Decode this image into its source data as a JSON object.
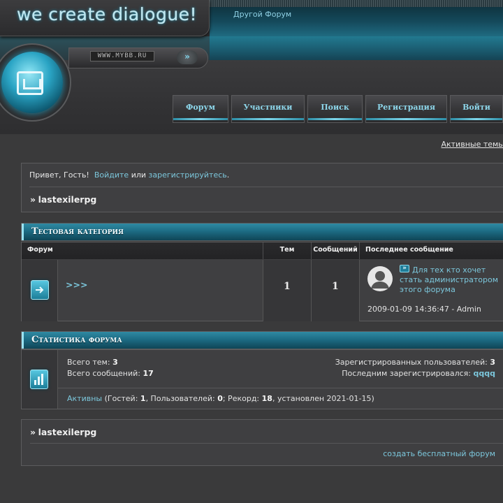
{
  "header": {
    "logo_text": "we create dialogue!",
    "other_forum_link": "Другой Форум",
    "site_url": "WWW.MYBB.RU",
    "url_arrow": "»"
  },
  "nav": [
    {
      "label": "Форум"
    },
    {
      "label": "Участники"
    },
    {
      "label": "Поиск"
    },
    {
      "label": "Регистрация"
    },
    {
      "label": "Войти"
    }
  ],
  "active_topics_link": "Активные темы",
  "welcome": {
    "greeting": "Привет, Гость!",
    "login_link": "Войдите",
    "or": "или",
    "register_link": "зарегистрируйтесь",
    "period": ".",
    "crumb_prefix": "»",
    "crumb": "lastexilerpg"
  },
  "category": {
    "title": "Тестовая категория",
    "columns": {
      "forum": "Форум",
      "topics": "Тем",
      "posts": "Сообщений",
      "last_post": "Последнее сообщение"
    },
    "rows": [
      {
        "name": ">>>",
        "topics": "1",
        "posts": "1",
        "last_post_link": "Для тех кто хочет стать администратором этого форума",
        "last_post_meta": "2009-01-09 14:36:47 - Admin"
      }
    ]
  },
  "stats": {
    "title": "Статистика форума",
    "total_topics_label": "Всего тем:",
    "total_topics": "3",
    "total_posts_label": "Всего сообщений:",
    "total_posts": "17",
    "registered_label": "Зарегистрированных пользователей:",
    "registered": "3",
    "last_registered_label": "Последним зарегистрировался:",
    "last_registered": "qqqq",
    "active_link": "Активны",
    "guests_label": "(Гостей:",
    "guests": "1",
    "users_label": ", Пользователей:",
    "users": "0",
    "record_label": "; Рекорд:",
    "record": "18",
    "established": ", установлен 2021-01-15)"
  },
  "footer": {
    "crumb_prefix": "»",
    "crumb": "lastexilerpg",
    "free_forum_link": "создать бесплатный форум"
  }
}
